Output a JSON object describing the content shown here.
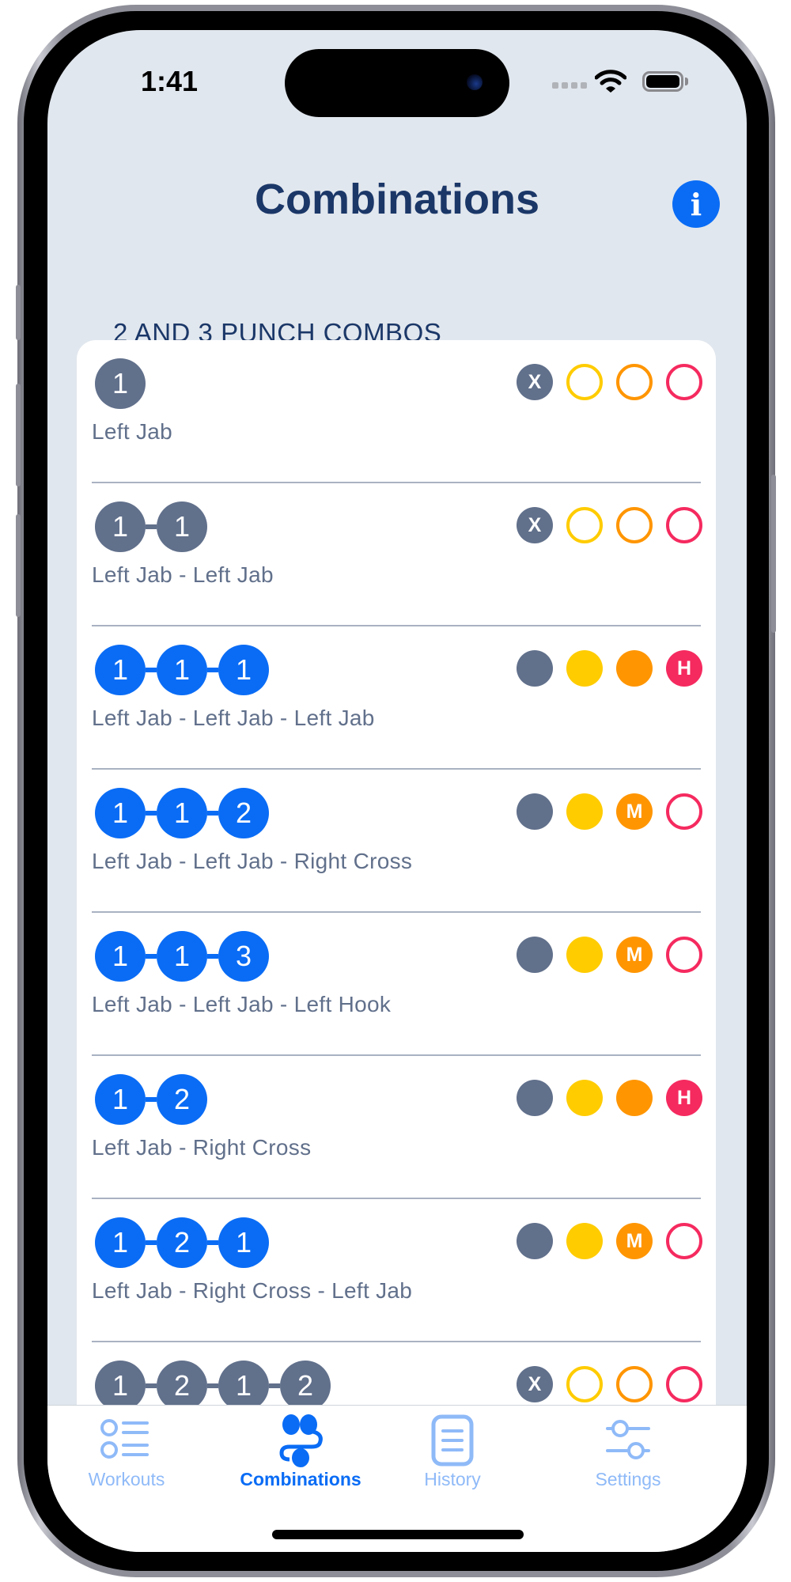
{
  "status_bar": {
    "time": "1:41"
  },
  "header": {
    "title": "Combinations",
    "info_icon": "info-circle-icon",
    "info_glyph": "i"
  },
  "section": {
    "header": "2 AND 3 PUNCH COMBOS"
  },
  "colors": {
    "accent": "#0a6cf5",
    "title": "#1b3768",
    "neutral": "#61708b",
    "easy": "#ffcc00",
    "medium": "#ff9500",
    "hard": "#f52a5f",
    "background": "#e1e7ee"
  },
  "combos": [
    {
      "punches": [
        "1"
      ],
      "label": "Left Jab",
      "style": "gray",
      "levels": [
        {
          "type": "x",
          "filled": true,
          "text": "X"
        },
        {
          "type": "easy",
          "filled": false,
          "text": ""
        },
        {
          "type": "medium",
          "filled": false,
          "text": ""
        },
        {
          "type": "hard",
          "filled": false,
          "text": ""
        }
      ]
    },
    {
      "punches": [
        "1",
        "1"
      ],
      "label": "Left Jab - Left Jab",
      "style": "gray",
      "levels": [
        {
          "type": "x",
          "filled": true,
          "text": "X"
        },
        {
          "type": "easy",
          "filled": false,
          "text": ""
        },
        {
          "type": "medium",
          "filled": false,
          "text": ""
        },
        {
          "type": "hard",
          "filled": false,
          "text": ""
        }
      ]
    },
    {
      "punches": [
        "1",
        "1",
        "1"
      ],
      "label": "Left Jab - Left Jab - Left Jab",
      "style": "blue",
      "levels": [
        {
          "type": "x",
          "filled": true,
          "text": ""
        },
        {
          "type": "easy",
          "filled": true,
          "text": ""
        },
        {
          "type": "medium",
          "filled": true,
          "text": ""
        },
        {
          "type": "hard",
          "filled": true,
          "text": "H"
        }
      ]
    },
    {
      "punches": [
        "1",
        "1",
        "2"
      ],
      "label": "Left Jab - Left Jab - Right Cross",
      "style": "blue",
      "levels": [
        {
          "type": "x",
          "filled": true,
          "text": ""
        },
        {
          "type": "easy",
          "filled": true,
          "text": ""
        },
        {
          "type": "medium",
          "filled": true,
          "text": "M"
        },
        {
          "type": "hard",
          "filled": false,
          "text": ""
        }
      ]
    },
    {
      "punches": [
        "1",
        "1",
        "3"
      ],
      "label": "Left Jab - Left Jab - Left Hook",
      "style": "blue",
      "levels": [
        {
          "type": "x",
          "filled": true,
          "text": ""
        },
        {
          "type": "easy",
          "filled": true,
          "text": ""
        },
        {
          "type": "medium",
          "filled": true,
          "text": "M"
        },
        {
          "type": "hard",
          "filled": false,
          "text": ""
        }
      ]
    },
    {
      "punches": [
        "1",
        "2"
      ],
      "label": "Left Jab - Right Cross",
      "style": "blue",
      "levels": [
        {
          "type": "x",
          "filled": true,
          "text": ""
        },
        {
          "type": "easy",
          "filled": true,
          "text": ""
        },
        {
          "type": "medium",
          "filled": true,
          "text": ""
        },
        {
          "type": "hard",
          "filled": true,
          "text": "H"
        }
      ]
    },
    {
      "punches": [
        "1",
        "2",
        "1"
      ],
      "label": "Left Jab - Right Cross - Left Jab",
      "style": "blue",
      "levels": [
        {
          "type": "x",
          "filled": true,
          "text": ""
        },
        {
          "type": "easy",
          "filled": true,
          "text": ""
        },
        {
          "type": "medium",
          "filled": true,
          "text": "M"
        },
        {
          "type": "hard",
          "filled": false,
          "text": ""
        }
      ]
    },
    {
      "punches": [
        "1",
        "2",
        "1",
        "2"
      ],
      "label": "",
      "style": "gray",
      "levels": [
        {
          "type": "x",
          "filled": true,
          "text": "X"
        },
        {
          "type": "easy",
          "filled": false,
          "text": ""
        },
        {
          "type": "medium",
          "filled": false,
          "text": ""
        },
        {
          "type": "hard",
          "filled": false,
          "text": ""
        }
      ]
    }
  ],
  "tabbar": {
    "tabs": [
      {
        "label": "Workouts",
        "icon": "list-bullet-icon",
        "active": false
      },
      {
        "label": "Combinations",
        "icon": "combinations-icon",
        "active": true
      },
      {
        "label": "History",
        "icon": "history-list-icon",
        "active": false
      },
      {
        "label": "Settings",
        "icon": "sliders-icon",
        "active": false
      }
    ]
  }
}
